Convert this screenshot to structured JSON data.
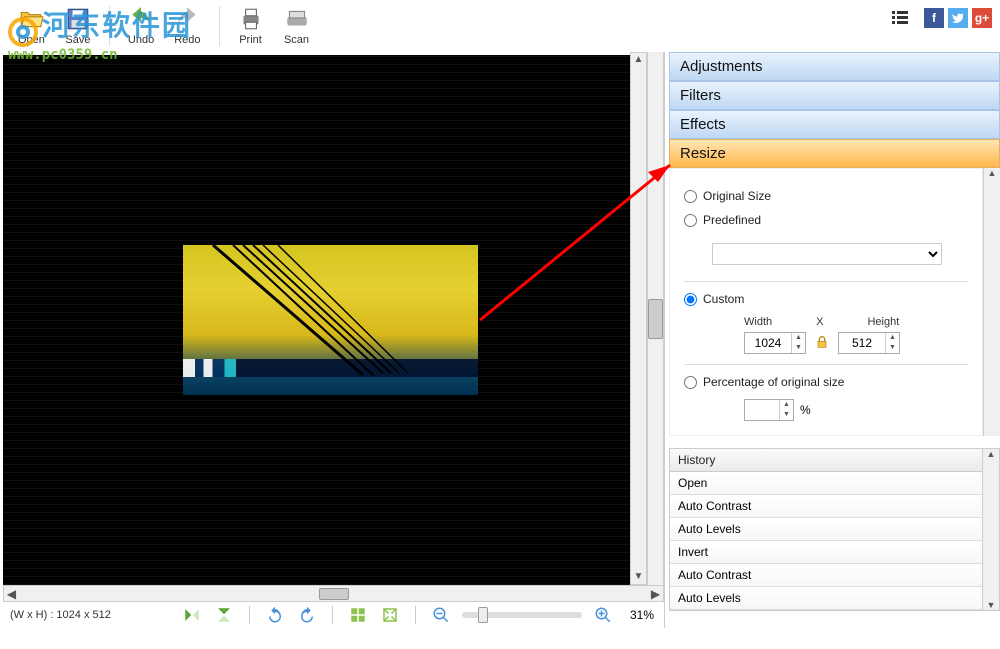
{
  "toolbar": {
    "open": "Open",
    "save": "Save",
    "undo": "Undo",
    "redo": "Redo",
    "print": "Print",
    "scan": "Scan"
  },
  "statusbar": {
    "dimensions": "(W x H) : 1024 x 512",
    "zoom_percent": "31%"
  },
  "panels": {
    "adjustments": "Adjustments",
    "filters": "Filters",
    "effects": "Effects",
    "resize": "Resize"
  },
  "resize": {
    "original_label": "Original Size",
    "predefined_label": "Predefined",
    "custom_label": "Custom",
    "width_label": "Width",
    "x_label": "X",
    "height_label": "Height",
    "width_value": "1024",
    "height_value": "512",
    "percentage_label": "Percentage of original size",
    "percent_value": "",
    "percent_sign": "%"
  },
  "history": {
    "header": "History",
    "items": [
      "Open",
      "Auto Contrast",
      "Auto Levels",
      "Invert",
      "Auto Contrast",
      "Auto Levels"
    ]
  },
  "watermark": {
    "line1": "河东软件园",
    "line2": "www.pc0359.cn"
  }
}
